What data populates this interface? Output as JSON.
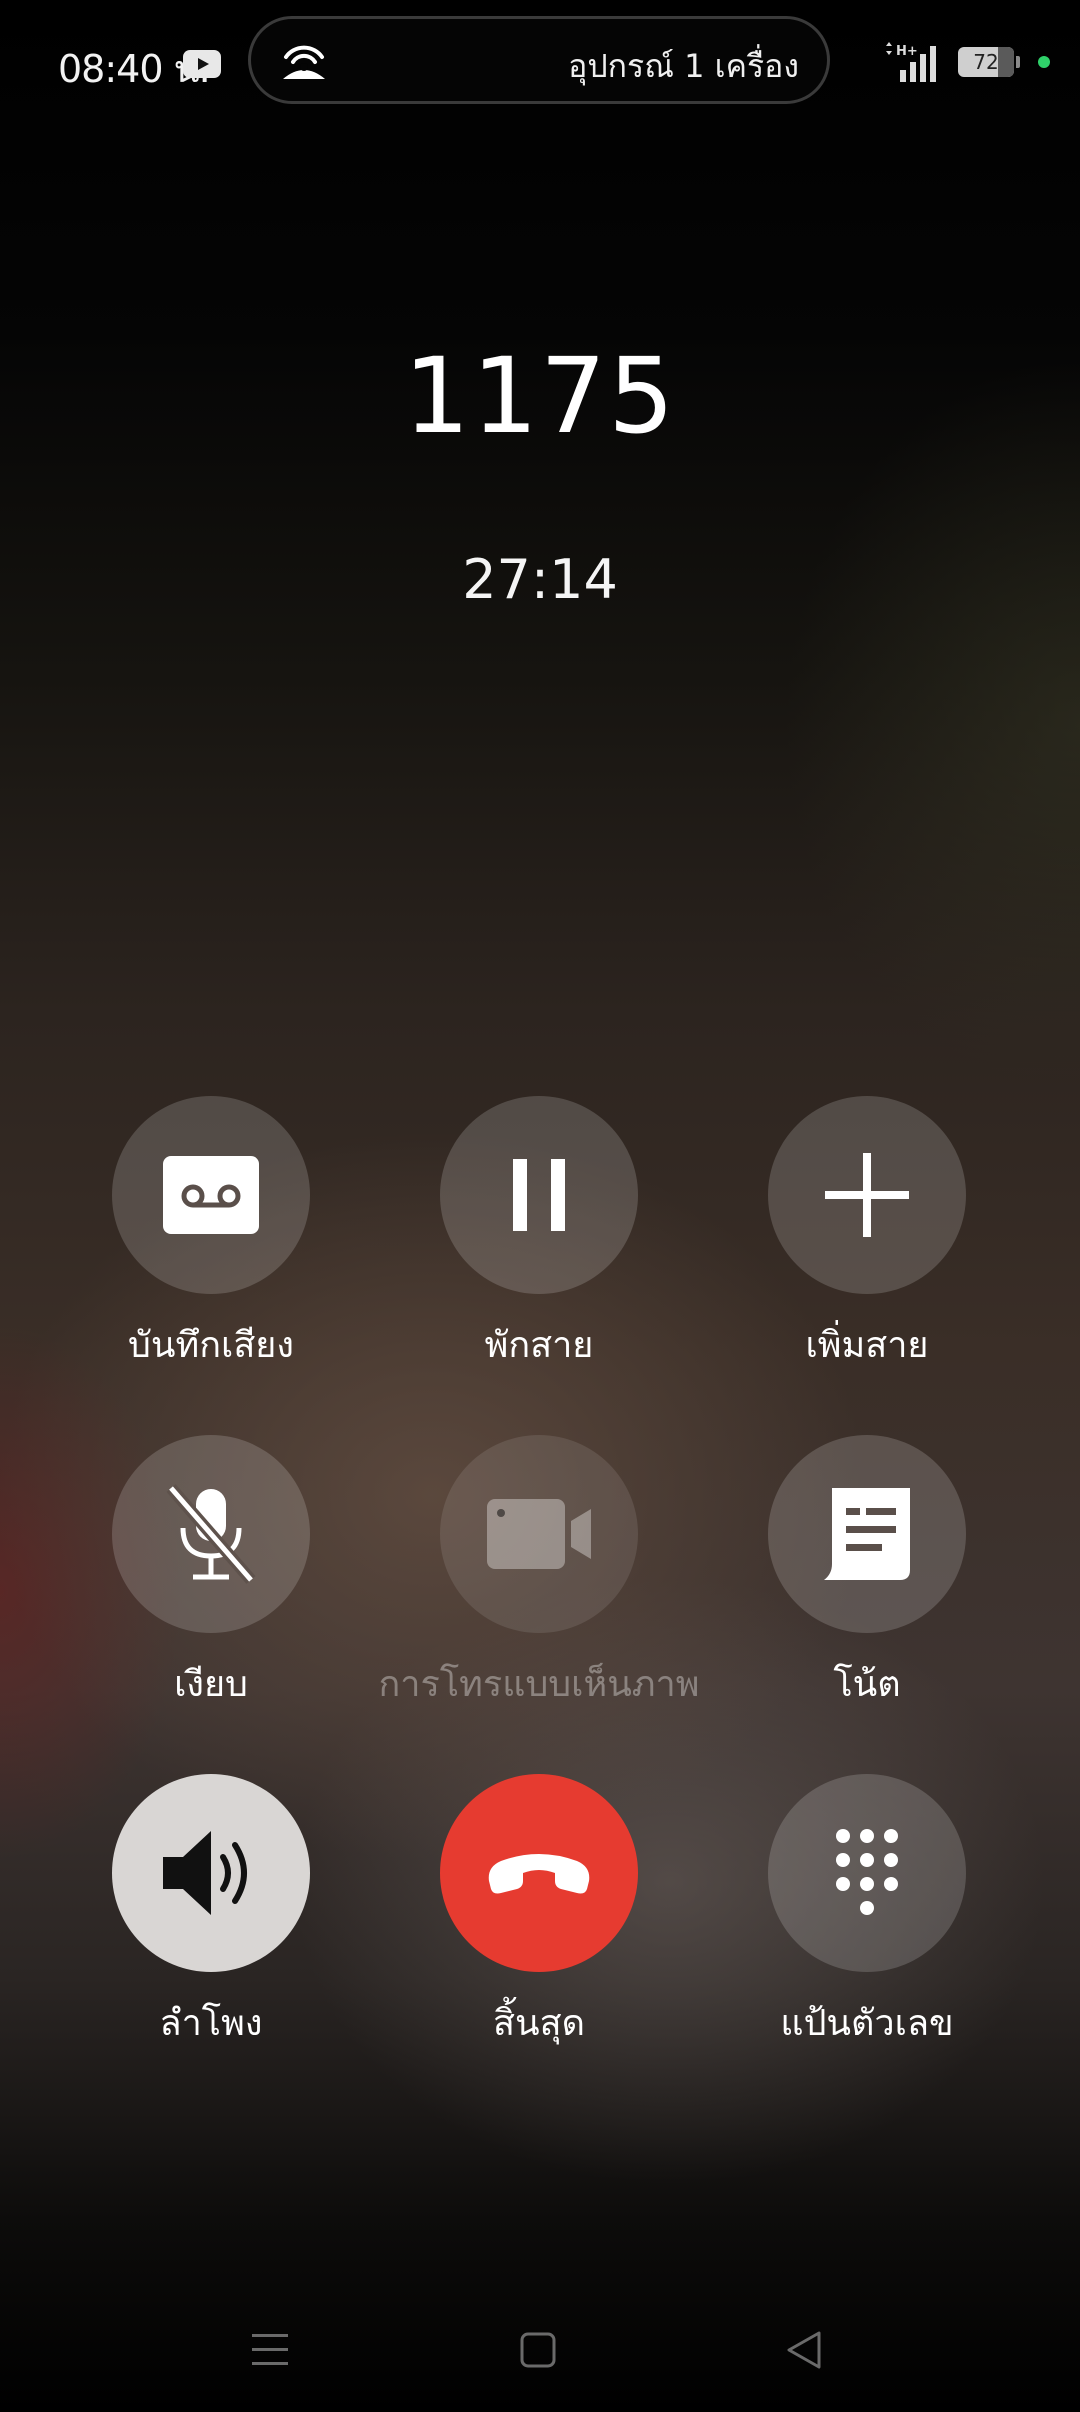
{
  "status_bar": {
    "time": "08:40 น.",
    "hotspot_text": "อุปกรณ์ 1 เครื่อง",
    "network_type": "H+",
    "battery_level": "72",
    "icons": [
      "youtube-icon",
      "hotspot-icon",
      "signal-icon",
      "battery-icon"
    ]
  },
  "call": {
    "number": "1175",
    "duration": "27:14"
  },
  "controls": {
    "record": {
      "label": "บันทึกเสียง",
      "icon": "voicemail-tape-icon"
    },
    "hold": {
      "label": "พักสาย",
      "icon": "pause-icon"
    },
    "add_call": {
      "label": "เพิ่มสาย",
      "icon": "plus-icon"
    },
    "mute": {
      "label": "เงียบ",
      "icon": "mic-off-icon"
    },
    "video_call": {
      "label": "การโทรแบบเห็นภาพ",
      "icon": "video-camera-icon",
      "enabled": false
    },
    "notes": {
      "label": "โน้ต",
      "icon": "note-icon"
    },
    "speaker": {
      "label": "ลำโพง",
      "icon": "speaker-icon",
      "active": true
    },
    "end_call": {
      "label": "สิ้นสุด",
      "icon": "hang-up-icon"
    },
    "keypad": {
      "label": "แป้นตัวเลข",
      "icon": "dialpad-icon"
    }
  },
  "colors": {
    "end_call": "#e63b30",
    "speaker_active": "#d9d6d4",
    "status_dot": "#2fd16a"
  },
  "nav_bar": {
    "icons": [
      "menu-icon",
      "home-icon",
      "back-icon"
    ]
  }
}
